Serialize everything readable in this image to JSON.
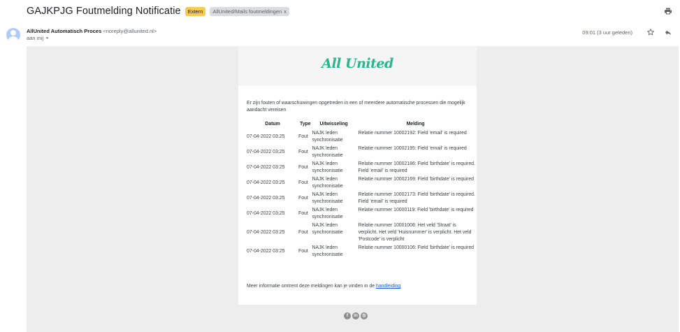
{
  "email": {
    "subject": "GAJKPJG Foutmelding Notificatie",
    "labels": {
      "extern": "Extern",
      "folder": "AllUnited/Mails foutmeldingen",
      "folder_close": "x"
    },
    "sender_name": "AllUnited Automatisch Proces",
    "sender_email": "<noreply@allunited.nl>",
    "to_line": "aan mij",
    "time": "09:01 (3 uur geleden)"
  },
  "body": {
    "logo_text": "All United",
    "intro": "Er zijn fouten of waarschuwingen opgetreden in een of meerdere automatische processen die mogelijk aandacht vereisen",
    "columns": [
      "Datum",
      "Type",
      "Uitwisseling",
      "Melding"
    ],
    "rows": [
      {
        "date": "07-04-2022 03:25",
        "type": "Fout",
        "exchange": "NAJK leden synchronisatie",
        "message": "Relatie nummer 10002192: Field 'email' is required"
      },
      {
        "date": "07-04-2022 03:25",
        "type": "Fout",
        "exchange": "NAJK leden synchronisatie",
        "message": "Relatie nummer 10002195: Field 'email' is required"
      },
      {
        "date": "07-04-2022 03:25",
        "type": "Fout",
        "exchange": "NAJK leden synchronisatie",
        "message": "Relatie nummer 10002186: Field 'birthdate' is required. Field 'email' is required"
      },
      {
        "date": "07-04-2022 03:25",
        "type": "Fout",
        "exchange": "NAJK leden synchronisatie",
        "message": "Relatie nummer 10002169: Field 'birthdate' is required"
      },
      {
        "date": "07-04-2022 03:25",
        "type": "Fout",
        "exchange": "NAJK leden synchronisatie",
        "message": "Relatie nummer 10002173: Field 'birthdate' is required. Field 'email' is required"
      },
      {
        "date": "07-04-2022 03:25",
        "type": "Fout",
        "exchange": "NAJK leden synchronisatie",
        "message": "Relatie nummer 10000119: Field 'birthdate' is required"
      },
      {
        "date": "07-04-2022 03:25",
        "type": "Fout",
        "exchange": "NAJK leden synchronisatie",
        "message": "Relatie nummer 10001008: Het veld 'Straat' is verplicht. Het veld 'Huisnummer' is verplicht. Het veld 'Postcode' is verplicht"
      },
      {
        "date": "07-04-2022 03:25",
        "type": "Fout",
        "exchange": "NAJK leden synchronisatie",
        "message": "Relatie nummer 10000106: Field 'birthdate' is required"
      }
    ],
    "more_info_text": "Meer informatie omtrent deze meldingen kan je vinden in de ",
    "more_info_link": "handleiding",
    "socials": [
      {
        "icon": "facebook-icon",
        "glyph": "f"
      },
      {
        "icon": "linkedin-icon",
        "glyph": "in"
      },
      {
        "icon": "instagram-icon",
        "glyph": "◎"
      }
    ]
  },
  "colors": {
    "extern_badge": "#f7cb4d",
    "logo": "#2ab58d",
    "link": "#1a5bd6",
    "frame_bg": "#ededed"
  }
}
